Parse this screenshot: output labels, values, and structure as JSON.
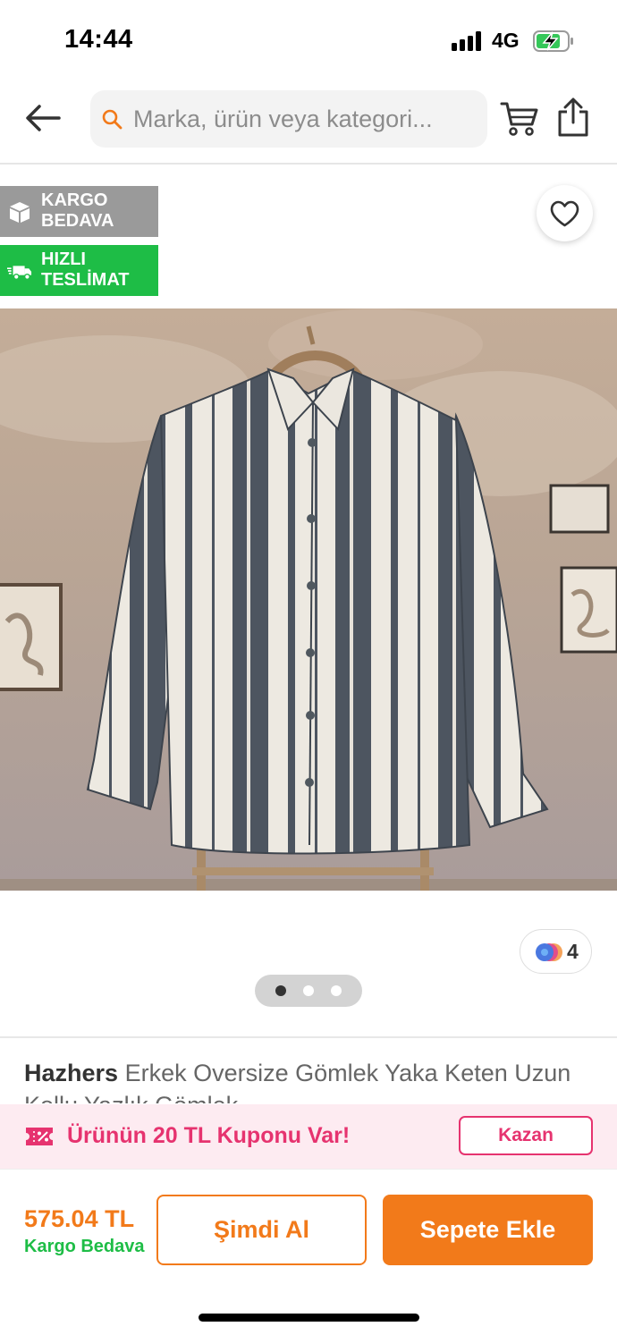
{
  "status_bar": {
    "time": "14:44",
    "network": "4G"
  },
  "header": {
    "search_placeholder": "Marka, ürün veya kategori..."
  },
  "badges": [
    {
      "icon": "package-icon",
      "label": "KARGO BEDAVA",
      "color": "#9a9a9a"
    },
    {
      "icon": "fast-truck-icon",
      "label": "HIZLI TESLİMAT",
      "color": "#1ebd46"
    }
  ],
  "gallery": {
    "color_count": "4",
    "page_count": 3,
    "active_page": 1
  },
  "product": {
    "brand": "Hazhers",
    "title": "Erkek Oversize Gömlek Yaka Keten Uzun Kollu Yazlık Gömlek"
  },
  "coupon": {
    "text": "Ürünün 20 TL Kuponu Var!",
    "button": "Kazan"
  },
  "purchase": {
    "price": "575.04 TL",
    "shipping": "Kargo Bedava",
    "buy_now": "Şimdi Al",
    "add_to_cart": "Sepete Ekle"
  },
  "colors": {
    "accent_orange": "#f27a1a",
    "green": "#1ebd46",
    "pink": "#e6336f",
    "grey_badge": "#9a9a9a"
  }
}
